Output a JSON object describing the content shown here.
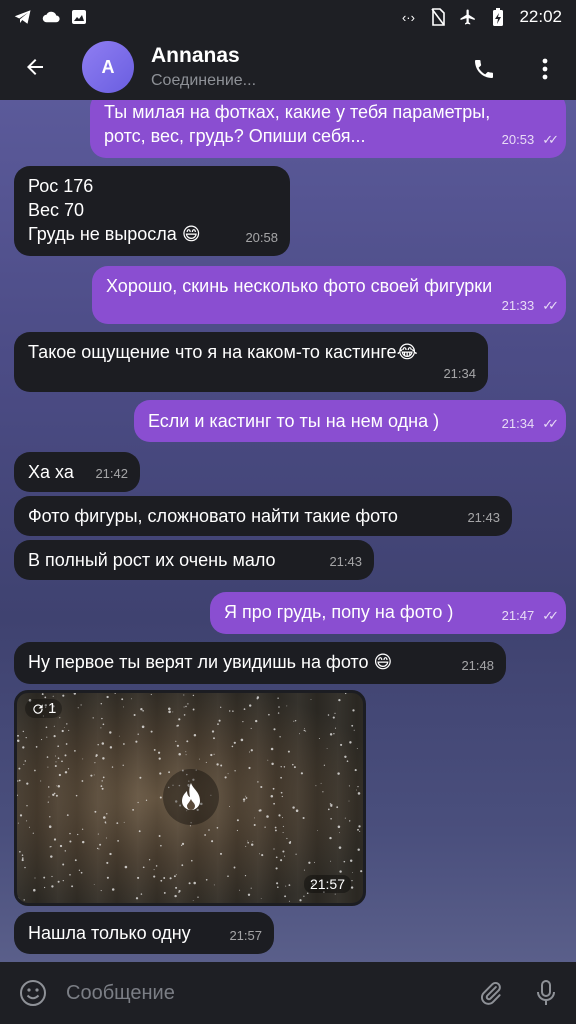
{
  "status_bar": {
    "time": "22:02",
    "icons": [
      "telegram-icon",
      "cloud-icon",
      "image-icon",
      "data-saver-icon",
      "no-sim-icon",
      "airplane-icon",
      "battery-charging-icon"
    ]
  },
  "header": {
    "avatar_letter": "A",
    "title": "Annanas",
    "status": "Соединение..."
  },
  "messages": [
    {
      "dir": "out",
      "lines": [
        "Ты милая на фотках, какие у тебя параметры,",
        "ротс, вес, грудь? Опиши себя..."
      ],
      "time": "20:53"
    },
    {
      "dir": "in",
      "lines": [
        "Рос 176",
        "Вес 70",
        "Грудь не выросла"
      ],
      "emoji": "😄",
      "time": "20:58"
    },
    {
      "dir": "out",
      "lines": [
        "Хорошо, скинь несколько фото своей фигурки"
      ],
      "time": "21:33"
    },
    {
      "dir": "in",
      "lines": [
        "Такое ощущение что я на каком-то кастинге"
      ],
      "emoji": "😂",
      "time": "21:34"
    },
    {
      "dir": "out",
      "lines": [
        "Если и кастинг то ты на нем одна )"
      ],
      "time": "21:34"
    },
    {
      "dir": "in",
      "lines": [
        "Ха ха"
      ],
      "time": "21:42"
    },
    {
      "dir": "in",
      "lines": [
        "Фото фигуры, сложновато найти такие фото"
      ],
      "time": "21:43"
    },
    {
      "dir": "in",
      "lines": [
        "В полный рост их очень мало"
      ],
      "time": "21:43"
    },
    {
      "dir": "out",
      "lines": [
        "Я про грудь, попу на фото )"
      ],
      "time": "21:47"
    },
    {
      "dir": "in",
      "lines": [
        "Ну первое ты верят ли увидишь на фото"
      ],
      "emoji": "😄",
      "time": "21:48"
    },
    {
      "dir": "in",
      "lines": [
        "Нашла только одну"
      ],
      "time": "21:57"
    }
  ],
  "photo": {
    "view_count": "1",
    "time": "21:57"
  },
  "input": {
    "placeholder": "Сообщение"
  },
  "colors": {
    "outgoing_bubble": "#8a4ed1",
    "incoming_bubble": "#1c1d22",
    "avatar": "#7b6ee8"
  }
}
